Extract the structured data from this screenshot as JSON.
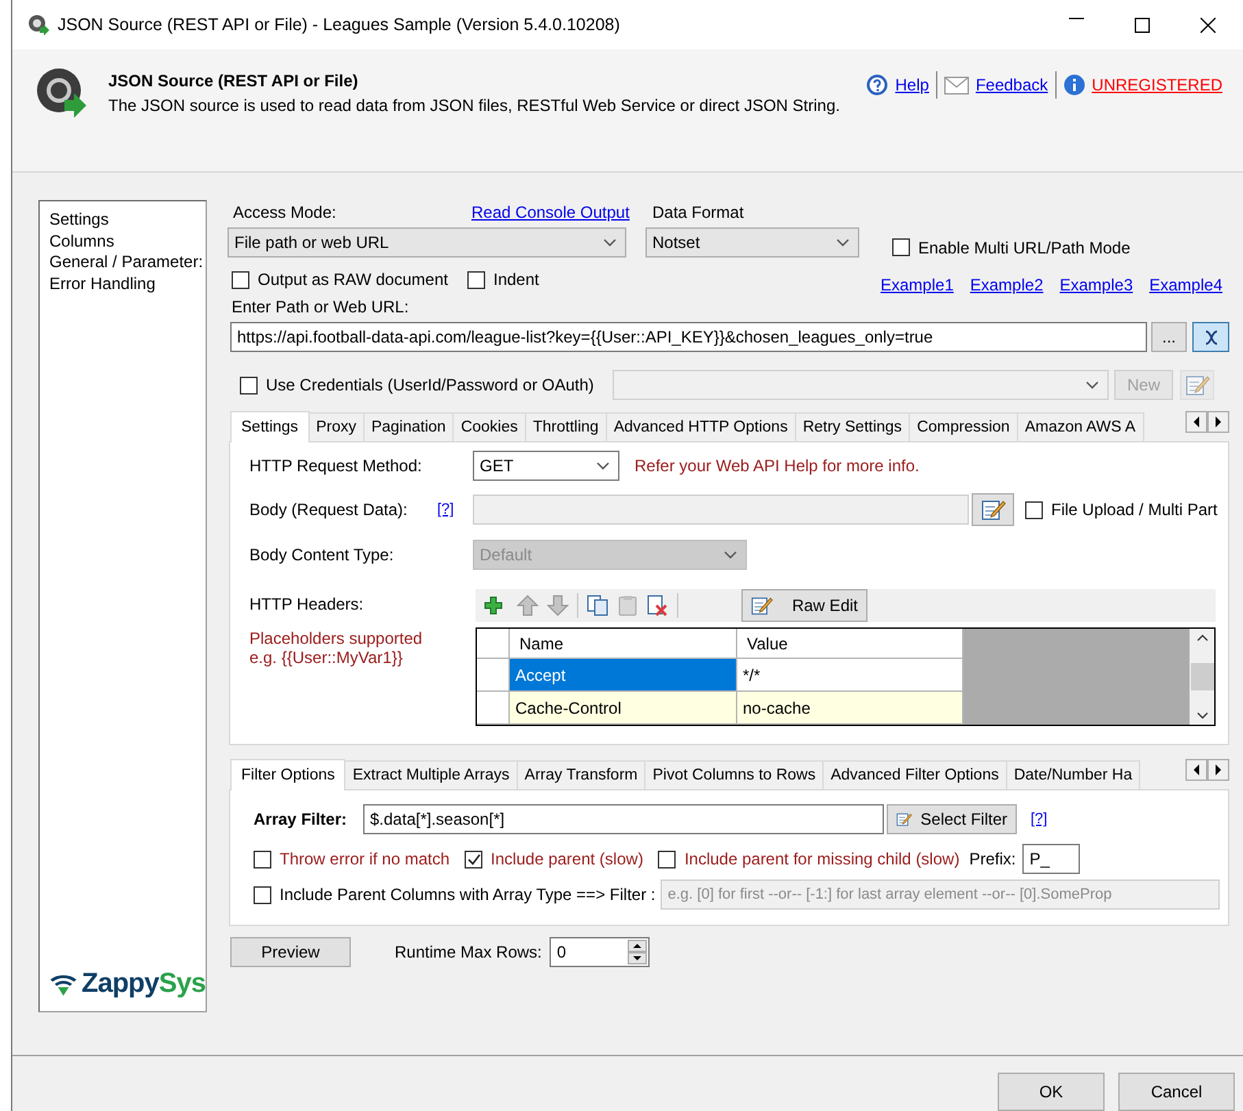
{
  "window": {
    "title": "JSON Source (REST API or File) - Leagues Sample (Version 5.4.0.10208)"
  },
  "header": {
    "title": "JSON Source (REST API or File)",
    "description": "The JSON source is used to read data from JSON files, RESTful Web Service or direct JSON String.",
    "links": [
      {
        "kind": "help",
        "label": "Help"
      },
      {
        "kind": "feedback",
        "label": "Feedback"
      },
      {
        "kind": "warning",
        "label": "UNREGISTERED"
      }
    ]
  },
  "sidebar": {
    "items": [
      "Settings",
      "Columns",
      "General / Parameter:",
      "Error Handling"
    ],
    "brand": [
      "Zappy",
      "Sys"
    ]
  },
  "source": {
    "access_mode": {
      "label": "Access Mode:",
      "value": "File path or web URL"
    },
    "console_link": "Read Console Output",
    "data_format": {
      "label": "Data Format",
      "value": "Notset"
    },
    "multi_url": {
      "label": "Enable Multi URL/Path Mode",
      "checked": false
    },
    "raw_document": {
      "label": "Output as RAW document",
      "checked": false
    },
    "indent": {
      "label": "Indent",
      "checked": false
    },
    "examples": [
      "Example1",
      "Example2",
      "Example3",
      "Example4"
    ],
    "url": {
      "label": "Enter Path or Web URL:",
      "value": "https://api.football-data-api.com/league-list?key={{User::API_KEY}}&chosen_leagues_only=true"
    },
    "browse_button": "...",
    "credentials": {
      "label": "Use Credentials (UserId/Password or OAuth)",
      "checked": false,
      "new_button": "New",
      "disabled": true
    }
  },
  "request_tabs": [
    {
      "label": "Settings",
      "selected": true
    },
    {
      "label": "Proxy",
      "selected": false
    },
    {
      "label": "Pagination",
      "selected": false
    },
    {
      "label": "Cookies",
      "selected": false
    },
    {
      "label": "Throttling",
      "selected": false
    },
    {
      "label": "Advanced HTTP Options",
      "selected": false
    },
    {
      "label": "Retry Settings",
      "selected": false
    },
    {
      "label": "Compression",
      "selected": false
    },
    {
      "label": "Amazon AWS A",
      "selected": false
    }
  ],
  "request": {
    "method": {
      "label": "HTTP Request Method:",
      "value": "GET"
    },
    "method_hint": "Refer your Web API Help for more info.",
    "body": {
      "label": "Body (Request Data):",
      "help": "[?]",
      "disabled": true
    },
    "file_upload": {
      "label": "File Upload / Multi Part",
      "checked": false
    },
    "content_type": {
      "label": "Body Content Type:",
      "value": "Default",
      "disabled": true
    },
    "headers": {
      "label": "HTTP Headers:",
      "note": "Placeholders supported\ne.g. {{User::MyVar1}}",
      "raw_edit": "Raw Edit",
      "columns": [
        "Name",
        "Value"
      ],
      "rows": [
        {
          "name": "Accept",
          "value": "*/*",
          "selected": true
        },
        {
          "name": "Cache-Control",
          "value": "no-cache",
          "selected": false
        }
      ]
    }
  },
  "filter_tabs": [
    {
      "label": "Filter Options",
      "selected": true
    },
    {
      "label": "Extract Multiple Arrays",
      "selected": false
    },
    {
      "label": "Array Transform",
      "selected": false
    },
    {
      "label": "Pivot Columns to Rows",
      "selected": false
    },
    {
      "label": "Advanced Filter Options",
      "selected": false
    },
    {
      "label": "Date/Number Ha",
      "selected": false
    }
  ],
  "filter": {
    "label": "Array Filter:",
    "value": "$.data[*].season[*]",
    "select_button": "Select Filter",
    "help": "[?]",
    "options": [
      {
        "label": "Throw error if no match",
        "checked": false
      },
      {
        "label": "Include parent (slow)",
        "checked": true
      },
      {
        "label": "Include parent for missing child (slow)",
        "checked": false
      }
    ],
    "prefix": {
      "label": "Prefix:",
      "value": "P_"
    },
    "parent_columns": {
      "label": "Include Parent Columns with Array Type ==> Filter :",
      "checked": false,
      "placeholder": "e.g. [0] for first --or-- [-1:] for last array element --or-- [0].SomeProp"
    }
  },
  "preview_button": "Preview",
  "max_rows": {
    "label": "Runtime Max Rows:",
    "value": "0"
  },
  "footer": {
    "buttons": [
      "OK",
      "Cancel"
    ]
  }
}
